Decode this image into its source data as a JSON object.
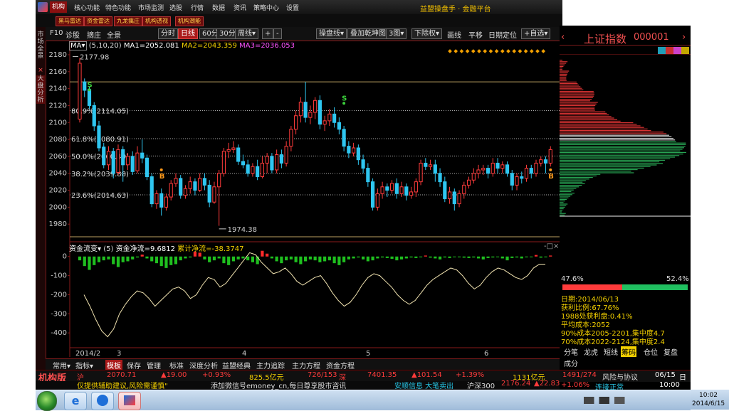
{
  "menu": {
    "items": [
      "机构",
      "核心功能",
      "特色功能",
      "市场监测",
      "选股",
      "行情",
      "数据",
      "资讯",
      "策略中心",
      "设置"
    ],
    "active": "机构",
    "title": "益盟操盘手 · 金融平台"
  },
  "subbar": {
    "buttons": [
      "黑马雷达",
      "资金雷达",
      "九龙擒庄",
      "机构透视",
      "机构潮能"
    ]
  },
  "left_strip": {
    "tab1": "市场全景",
    "tab2": "大盘分析",
    "close": "×"
  },
  "toolbar": {
    "items": [
      "F10",
      "诊股",
      "摘庄",
      "全景"
    ],
    "period_tabs": [
      "分时",
      "日线",
      "60分",
      "30分",
      "周线▾"
    ],
    "period_selected": "日线",
    "zoom_plus": "+",
    "zoom_minus": "-",
    "tools": [
      "操盘线▾",
      "叠加乾坤图▾",
      "3图▾",
      "下除权▾",
      "画线",
      "平移",
      "日期定位",
      "+自选▾"
    ]
  },
  "ma_legend": {
    "indicator": "MA▾",
    "params": "(5,10,20)",
    "ma1": "MA1=2052.081",
    "ma2": "MA2=2043.359",
    "ma3": "MA3=2036.053"
  },
  "fund_legend": {
    "indicator": "资金流变▾",
    "param": "(5)",
    "net": "资金净流=9.6812",
    "cum": "累计净流=-38.3747",
    "controls": "-□×"
  },
  "chart_data": {
    "type": "candlestick",
    "y_axis": {
      "min": 1960,
      "max": 2180,
      "ticks": [
        1980,
        2000,
        2020,
        2040,
        2060,
        2080,
        2100,
        2120,
        2140,
        2160,
        2180
      ]
    },
    "annotations": {
      "high_label": "2177.98",
      "low_label": "1974.38",
      "fib_levels": [
        {
          "label": "80.9%(2114.05)",
          "value": 2114.05
        },
        {
          "label": "61.8%(2080.91)",
          "value": 2080.91
        },
        {
          "label": "50.0%(2060.40)",
          "value": 2060.4
        },
        {
          "label": "38.2%(2039.88)",
          "value": 2039.88
        },
        {
          "label": "23.6%(2014.63)",
          "value": 2014.63
        }
      ],
      "signals": [
        "S",
        "S",
        "B",
        "B"
      ]
    },
    "x_labels": [
      "2014/2",
      "3",
      "4",
      "5",
      "6"
    ],
    "candles": [
      [
        2104,
        2170,
        2100,
        2176
      ],
      [
        2148,
        2138,
        2130,
        2152
      ],
      [
        2139,
        2120,
        2116,
        2142
      ],
      [
        2120,
        2096,
        2090,
        2124
      ],
      [
        2096,
        2070,
        2066,
        2102
      ],
      [
        2071,
        2050,
        2046,
        2076
      ],
      [
        2050,
        2066,
        2044,
        2072
      ],
      [
        2066,
        2040,
        2034,
        2070
      ],
      [
        2041,
        2068,
        2038,
        2074
      ],
      [
        2068,
        2050,
        2030,
        2072
      ],
      [
        2050,
        2060,
        2044,
        2064
      ],
      [
        2060,
        2042,
        2038,
        2066
      ],
      [
        2043,
        2064,
        2040,
        2072
      ],
      [
        2064,
        2058,
        2052,
        2080
      ],
      [
        2058,
        2036,
        2032,
        2062
      ],
      [
        2036,
        2004,
        2000,
        2040
      ],
      [
        2004,
        2016,
        1998,
        2020
      ],
      [
        2016,
        2000,
        1990,
        2022
      ],
      [
        2000,
        2012,
        1996,
        2016
      ],
      [
        2012,
        2028,
        2008,
        2032
      ],
      [
        2028,
        2034,
        2024,
        2040
      ],
      [
        2034,
        2014,
        2010,
        2038
      ],
      [
        2014,
        2022,
        2010,
        2026
      ],
      [
        2022,
        2030,
        2016,
        2036
      ],
      [
        2030,
        2020,
        2014,
        2034
      ],
      [
        2020,
        2034,
        2018,
        2040
      ],
      [
        2034,
        2026,
        2020,
        2040
      ],
      [
        2026,
        2006,
        2000,
        2032
      ],
      [
        2006,
        2024,
        2004,
        2030
      ],
      [
        2024,
        2040,
        1978,
        2044
      ],
      [
        2040,
        2066,
        2036,
        2070
      ],
      [
        2066,
        2068,
        2058,
        2076
      ],
      [
        2068,
        2070,
        2064,
        2078
      ],
      [
        2070,
        2054,
        2050,
        2074
      ],
      [
        2054,
        2050,
        2046,
        2062
      ],
      [
        2050,
        2040,
        2036,
        2056
      ],
      [
        2040,
        2048,
        2036,
        2052
      ],
      [
        2048,
        2036,
        2032,
        2056
      ],
      [
        2036,
        2052,
        2034,
        2060
      ],
      [
        2052,
        2060,
        2040,
        2064
      ],
      [
        2060,
        2044,
        2040,
        2064
      ],
      [
        2044,
        2062,
        2040,
        2068
      ],
      [
        2062,
        2052,
        2046,
        2068
      ],
      [
        2052,
        2072,
        2048,
        2078
      ],
      [
        2072,
        2092,
        2066,
        2096
      ],
      [
        2092,
        2108,
        2086,
        2114
      ],
      [
        2108,
        2124,
        2100,
        2130
      ],
      [
        2124,
        2106,
        2100,
        2148
      ],
      [
        2106,
        2112,
        2098,
        2120
      ],
      [
        2112,
        2126,
        2104,
        2130
      ],
      [
        2126,
        2098,
        2092,
        2132
      ],
      [
        2098,
        2102,
        2090,
        2108
      ],
      [
        2102,
        2110,
        2096,
        2116
      ],
      [
        2110,
        2100,
        2094,
        2118
      ],
      [
        2100,
        2092,
        2086,
        2106
      ],
      [
        2092,
        2072,
        2066,
        2096
      ],
      [
        2072,
        2064,
        2058,
        2078
      ],
      [
        2064,
        2070,
        2060,
        2076
      ],
      [
        2070,
        2056,
        2050,
        2074
      ],
      [
        2056,
        2046,
        2040,
        2062
      ],
      [
        2046,
        2030,
        2024,
        2052
      ],
      [
        2030,
        2000,
        1996,
        2034
      ],
      [
        2000,
        2016,
        1996,
        2022
      ],
      [
        2016,
        2024,
        2010,
        2030
      ],
      [
        2024,
        2020,
        2012,
        2028
      ],
      [
        2020,
        2028,
        2016,
        2032
      ],
      [
        2028,
        2016,
        2010,
        2034
      ],
      [
        2016,
        2024,
        2012,
        2030
      ],
      [
        2024,
        2014,
        2008,
        2028
      ],
      [
        2014,
        2018,
        2010,
        2024
      ],
      [
        2018,
        2030,
        2012,
        2034
      ],
      [
        2030,
        2052,
        2026,
        2056
      ],
      [
        2052,
        2048,
        2044,
        2058
      ],
      [
        2048,
        2050,
        2044,
        2056
      ],
      [
        2050,
        2040,
        2030,
        2056
      ],
      [
        2040,
        2030,
        2024,
        2046
      ],
      [
        2030,
        2010,
        2006,
        2036
      ],
      [
        2010,
        2018,
        2004,
        2024
      ],
      [
        2018,
        2004,
        1996,
        2022
      ],
      [
        2004,
        2016,
        2000,
        2020
      ],
      [
        2016,
        2026,
        2010,
        2030
      ],
      [
        2026,
        2032,
        2022,
        2036
      ],
      [
        2032,
        2040,
        2028,
        2046
      ],
      [
        2040,
        2044,
        2034,
        2050
      ],
      [
        2044,
        2046,
        2038,
        2050
      ],
      [
        2046,
        2040,
        2034,
        2050
      ],
      [
        2040,
        2052,
        2036,
        2058
      ],
      [
        2052,
        2046,
        2040,
        2058
      ],
      [
        2046,
        2050,
        2040,
        2054
      ],
      [
        2050,
        2040,
        2036,
        2054
      ],
      [
        2040,
        2026,
        2020,
        2044
      ],
      [
        2026,
        2036,
        2020,
        2040
      ],
      [
        2036,
        2034,
        2028,
        2042
      ],
      [
        2034,
        2046,
        2030,
        2050
      ],
      [
        2046,
        2040,
        2034,
        2050
      ],
      [
        2040,
        2052,
        2036,
        2056
      ],
      [
        2052,
        2056,
        2048,
        2060
      ],
      [
        2056,
        2052,
        2040,
        2060
      ],
      [
        2052,
        2068,
        2048,
        2072
      ]
    ],
    "fund_flow": {
      "y_ticks": [
        0,
        -100,
        -200,
        -300,
        -400
      ],
      "y_range": [
        -470,
        40
      ],
      "bars": [
        -20,
        -50,
        -70,
        -45,
        -30,
        -20,
        -15,
        -40,
        -55,
        -30,
        -25,
        -15,
        -5,
        10,
        -10,
        -25,
        -35,
        -50,
        -60,
        -45,
        -40,
        -20,
        -10,
        -5,
        25,
        20,
        -15,
        -30,
        -20,
        -10,
        -35,
        -45,
        -25,
        -15,
        -10,
        -20,
        -30,
        -40,
        30,
        15,
        -10,
        -25,
        -35,
        -20,
        -15,
        -30,
        -40,
        -25,
        -15,
        -20,
        -30,
        -25,
        -20,
        -35,
        -45,
        -30,
        -15,
        -10,
        -5,
        -15,
        -25,
        -20,
        -10,
        -5,
        -8,
        -12,
        -20,
        -15,
        -10,
        -5,
        -8,
        -4,
        5,
        -6,
        -10,
        -15,
        -5,
        -8,
        -3,
        -4,
        -6,
        -8,
        -5,
        -10,
        -15,
        -8,
        -5,
        -3,
        -10,
        -20,
        -8,
        -5,
        -10,
        -4,
        -2,
        8,
        -6,
        -4,
        5
      ],
      "line": [
        -200,
        -260,
        -330,
        -390,
        -420,
        -380,
        -300,
        -250,
        -210,
        -180,
        -190,
        -220,
        -260,
        -230,
        -200,
        -170,
        -160,
        -180,
        -220,
        -200,
        -150,
        -110,
        -120,
        -160,
        -140,
        -100,
        -60,
        -20,
        20,
        10,
        -30,
        -60,
        -90,
        -80,
        -60,
        -90,
        -130,
        -150,
        -130,
        -110,
        -100,
        -140,
        -190,
        -230,
        -260,
        -240,
        -200,
        -150,
        -110,
        -90,
        -100,
        -130,
        -160,
        -200,
        -230,
        -250,
        -230,
        -190,
        -150,
        -120,
        -100,
        -80,
        -60,
        -70,
        -100,
        -140,
        -170,
        -150,
        -110,
        -80,
        -60,
        -70,
        -90,
        -110,
        -120,
        -100,
        -60,
        -40,
        -40
      ]
    }
  },
  "bottom_tabs": {
    "items": [
      "常用▾",
      "指标▾",
      "模板",
      "保存",
      "管理",
      "标准",
      "深度分析",
      "益盟经典",
      "主力追踪",
      "主力方程",
      "资金方程"
    ],
    "selected": "模板"
  },
  "ticker": {
    "label": "机构版",
    "sh_label": "沪",
    "sh_value": "2070.71",
    "sh_change": "▲19.00",
    "sh_pct": "+0.93%",
    "sh_amount": "825.5亿元",
    "sh_updown": "726/153",
    "sz_label": "深",
    "sz_value": "7401.35",
    "sz_change": "▲101.54",
    "sz_pct": "+1.39%",
    "sz_amount": "1131亿元",
    "sz_updown": "1491/274",
    "risk": "风险与协议",
    "date": "06/15",
    "time": "10:00",
    "week": "日"
  },
  "marquee": {
    "tip": "仅提供辅助建议,风险需谨慎\"",
    "wechat": "添加微信号emoney_cn,每日尊享股市咨讯",
    "signal": "安顺信息 大笔卖出",
    "hs300_label": "沪深300",
    "hs300_value": "2176.24",
    "hs300_change": "▲22.83",
    "hs300_pct": "+1.06%",
    "conn": "连接正常"
  },
  "right_panel": {
    "name": "上证指数",
    "code": "000001",
    "pct_left": "47.6%",
    "pct_right": "52.4%",
    "date_line": "日期:2014/06/13",
    "profit_ratio": "获利比例:67.76%",
    "profit_line": "1988处获利盘:0.41%",
    "avg_cost": "平均成本:2052",
    "cost90": "90%成本2005-2201,集中度4.7",
    "cost70": "70%成本2022-2124,集中度2.4",
    "tabs": [
      "分笔",
      "龙虎",
      "短线",
      "筹码",
      "仓位",
      "复盘"
    ],
    "tab_selected": "筹码",
    "extra": "成分"
  },
  "taskbar": {
    "time": "10:02",
    "date": "2014/6/15"
  }
}
